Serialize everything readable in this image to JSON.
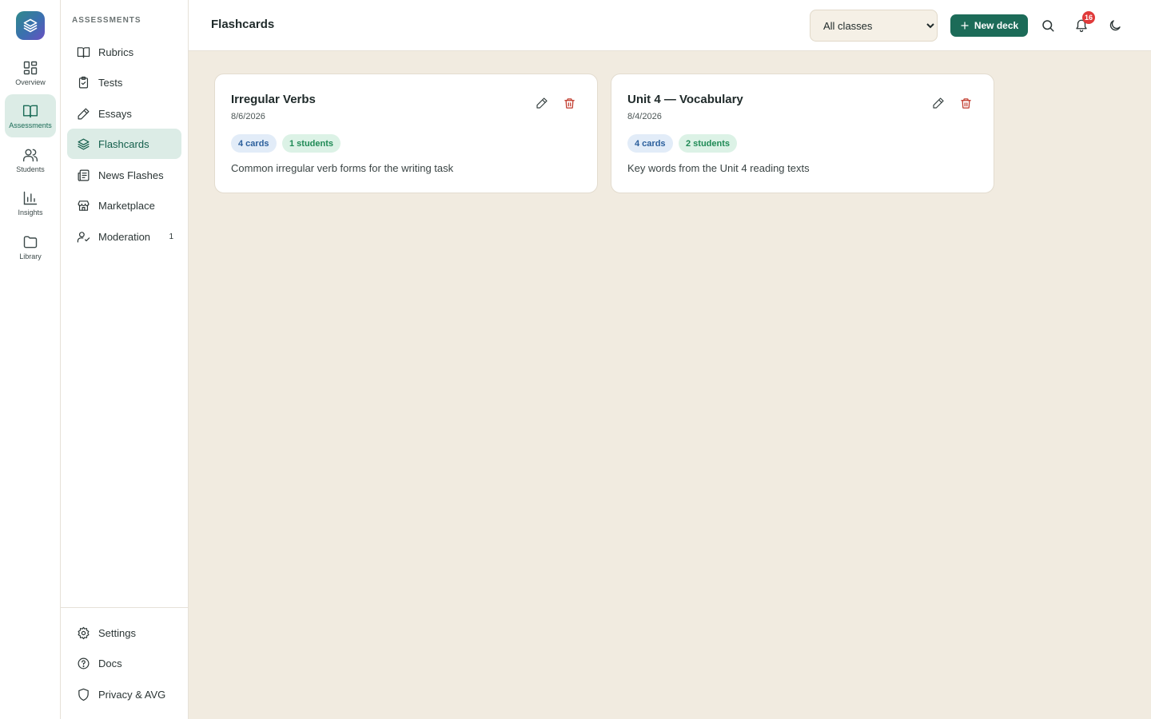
{
  "rail": {
    "logo_icon": "layers-icon",
    "items": [
      {
        "label": "Overview",
        "icon": "grid-icon",
        "active": false
      },
      {
        "label": "Assessments",
        "icon": "book-open-icon",
        "active": true
      },
      {
        "label": "Students",
        "icon": "users-icon",
        "active": false
      },
      {
        "label": "Insights",
        "icon": "bar-chart-icon",
        "active": false
      },
      {
        "label": "Library",
        "icon": "folder-icon",
        "active": false
      }
    ]
  },
  "sidebar": {
    "section_title": "ASSESSMENTS",
    "items": [
      {
        "label": "Rubrics",
        "icon": "book-icon"
      },
      {
        "label": "Tests",
        "icon": "clipboard-check-icon"
      },
      {
        "label": "Essays",
        "icon": "pen-icon"
      },
      {
        "label": "Flashcards",
        "icon": "layers-icon",
        "active": true
      },
      {
        "label": "News Flashes",
        "icon": "newspaper-icon"
      },
      {
        "label": "Marketplace",
        "icon": "store-icon"
      },
      {
        "label": "Moderation",
        "icon": "user-check-icon",
        "badge": "1"
      }
    ],
    "footer": [
      {
        "label": "Settings",
        "icon": "gear-icon"
      },
      {
        "label": "Docs",
        "icon": "help-circle-icon"
      },
      {
        "label": "Privacy & AVG",
        "icon": "shield-icon"
      }
    ]
  },
  "header": {
    "title": "Flashcards",
    "class_filter": {
      "selected": "All classes"
    },
    "new_deck_label": "New deck",
    "notification_count": "16"
  },
  "decks": [
    {
      "title": "Irregular Verbs",
      "date": "8/6/2026",
      "cards": "4 cards",
      "students": "1 students",
      "description": "Common irregular verb forms for the writing task"
    },
    {
      "title": "Unit 4 — Vocabulary",
      "date": "8/4/2026",
      "cards": "4 cards",
      "students": "2 students",
      "description": "Key words from the Unit 4 reading texts"
    }
  ],
  "colors": {
    "accent": "#1c6b58",
    "active_bg": "#dcece6",
    "background": "#f1ebe0",
    "danger": "#c0392b",
    "notification": "#e03a3a"
  }
}
